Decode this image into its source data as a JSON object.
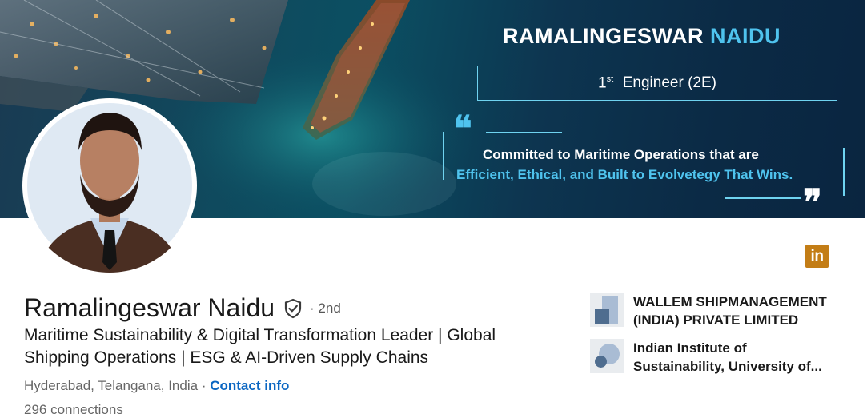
{
  "banner": {
    "name_first": "RAMALINGESWAR",
    "name_last": "NAIDU",
    "role_sup": "st",
    "role_num": "1",
    "role_text": "Engineer (2E)",
    "quote_open": "❝",
    "quote_close": "❞",
    "quote_line1": "Committed to Maritime Operations that are",
    "quote_line2": "Efficient, Ethical, and Built to Evolvetegy That Wins.",
    "accent_color": "#4fc3ee"
  },
  "profile": {
    "name": "Ramalingeswar Naidu",
    "degree": "· 2nd",
    "headline": "Maritime Sustainability & Digital Transformation Leader | Global Shipping Operations | ESG & AI-Driven Supply Chains",
    "location": "Hyderabad, Telangana, India",
    "separator": "·",
    "contact_info": "Contact info",
    "connections": "296 connections"
  },
  "linkedin_badge": "in",
  "organizations": [
    {
      "name": "WALLEM SHIPMANAGEMENT (INDIA) PRIVATE LIMITED",
      "icon": "company-logo-icon"
    },
    {
      "name": "Indian Institute of Sustainability, University of...",
      "icon": "school-logo-icon"
    }
  ]
}
